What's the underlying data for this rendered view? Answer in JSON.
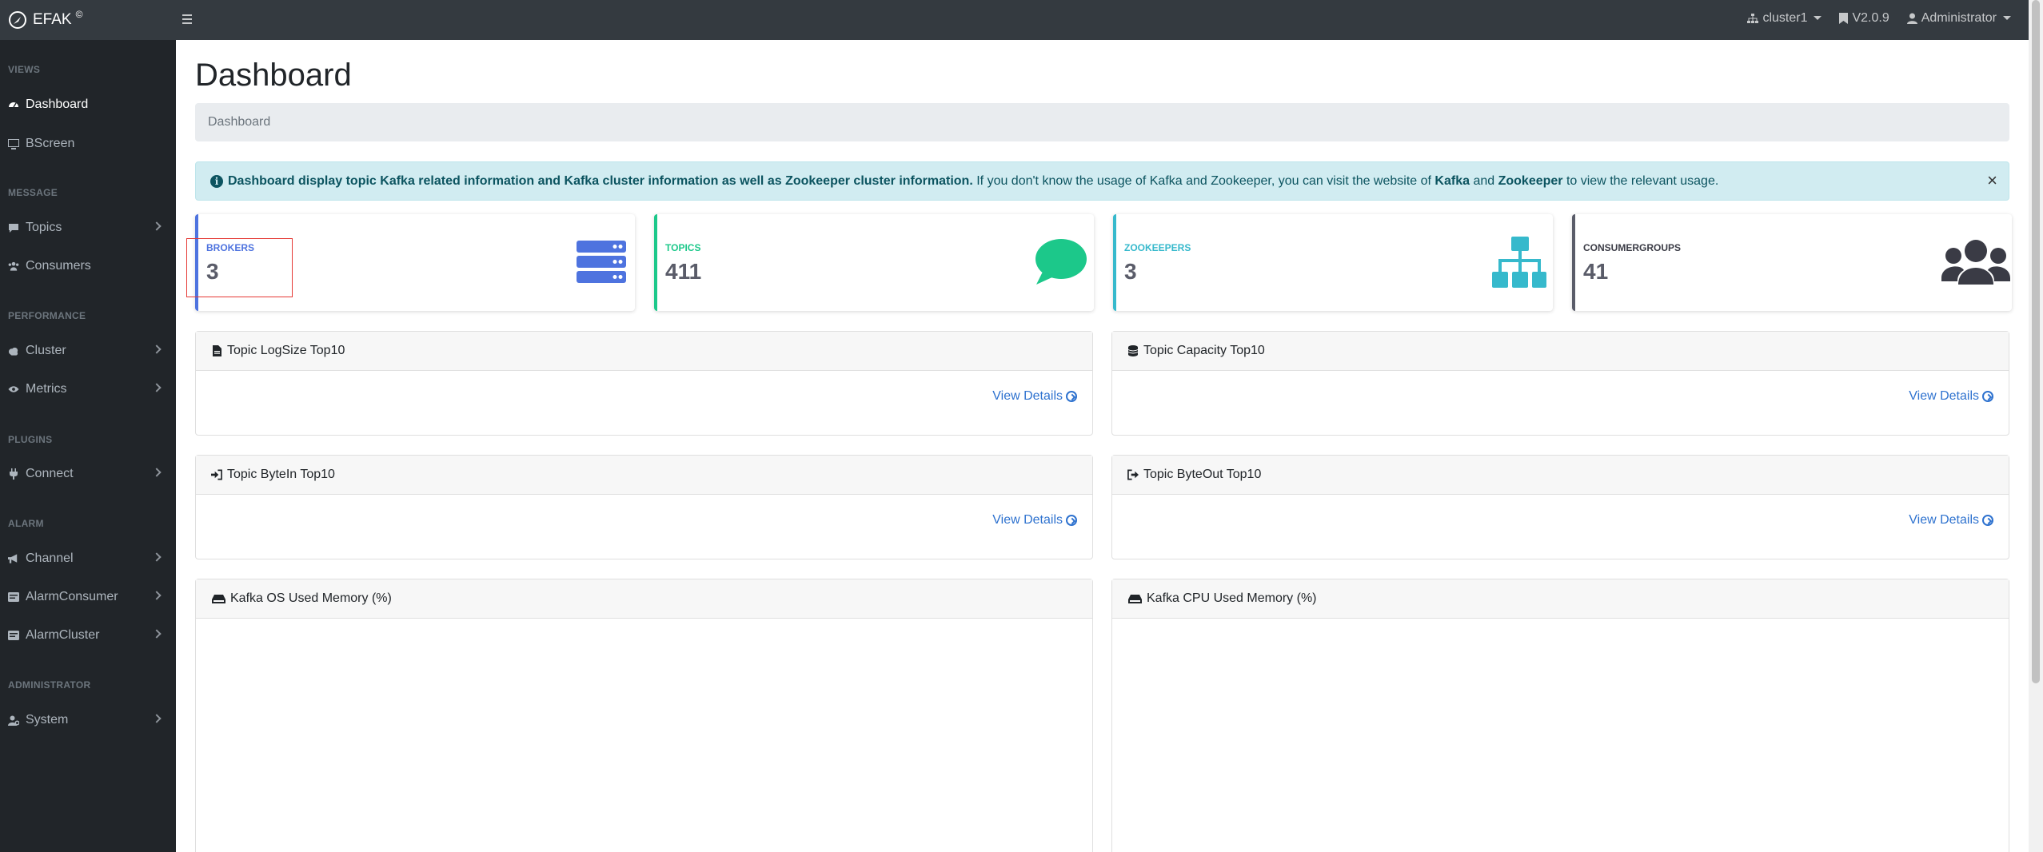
{
  "topbar": {
    "brand": "EFAK",
    "brand_mark": "©",
    "cluster": "cluster1",
    "version": "V2.0.9",
    "user": "Administrator"
  },
  "sidebar": {
    "sections": [
      {
        "heading": "VIEWS",
        "items": [
          {
            "label": "Dashboard",
            "icon": "dashboard-icon",
            "active": true
          },
          {
            "label": "BScreen",
            "icon": "monitor-icon"
          }
        ]
      },
      {
        "heading": "MESSAGE",
        "items": [
          {
            "label": "Topics",
            "icon": "topics-icon"
          },
          {
            "label": "Consumers",
            "icon": "users-icon"
          }
        ]
      },
      {
        "heading": "PERFORMANCE",
        "items": [
          {
            "label": "Cluster",
            "icon": "cloud-icon"
          },
          {
            "label": "Metrics",
            "icon": "eye-icon"
          }
        ]
      },
      {
        "heading": "PLUGINS",
        "items": [
          {
            "label": "Connect",
            "icon": "plug-icon"
          }
        ]
      },
      {
        "heading": "ALARM",
        "items": [
          {
            "label": "Channel",
            "icon": "bullhorn-icon"
          },
          {
            "label": "AlarmConsumer",
            "icon": "bell-icon"
          },
          {
            "label": "AlarmCluster",
            "icon": "bell-icon"
          }
        ]
      },
      {
        "heading": "ADMINISTRATOR",
        "items": [
          {
            "label": "System",
            "icon": "user-icon"
          }
        ]
      }
    ]
  },
  "main": {
    "title": "Dashboard",
    "breadcrumb": "Dashboard",
    "alert": {
      "bold": "Dashboard display topic Kafka related information and Kafka cluster information as well as Zookeeper cluster information.",
      "text1": " If you don't know the usage of Kafka and Zookeeper, you can visit the website of ",
      "kafka": "Kafka",
      "and": " and ",
      "zookeeper": "Zookeeper",
      "text2": " to view the relevant usage.",
      "close": "×"
    },
    "cards": [
      {
        "label": "BROKERS",
        "value": "3",
        "color": "#4e73df",
        "icon": "server-icon"
      },
      {
        "label": "TOPICS",
        "value": "411",
        "color": "#1cc88a",
        "icon": "comment-icon"
      },
      {
        "label": "ZOOKEEPERS",
        "value": "3",
        "color": "#36b9cc",
        "icon": "sitemap-icon"
      },
      {
        "label": "CONSUMERGROUPS",
        "value": "41",
        "color": "#5a5c69",
        "icon": "users-icon"
      }
    ],
    "panels": [
      {
        "title": "Topic LogSize Top10",
        "icon": "file-icon",
        "link": "View Details"
      },
      {
        "title": "Topic Capacity Top10",
        "icon": "database-icon",
        "link": "View Details"
      },
      {
        "title": "Topic ByteIn Top10",
        "icon": "sign-in-icon",
        "link": "View Details"
      },
      {
        "title": "Topic ByteOut Top10",
        "icon": "sign-out-icon",
        "link": "View Details"
      },
      {
        "title": "Kafka OS Used Memory (%)",
        "icon": "hdd-icon"
      },
      {
        "title": "Kafka CPU Used Memory (%)",
        "icon": "hdd-icon"
      }
    ]
  }
}
